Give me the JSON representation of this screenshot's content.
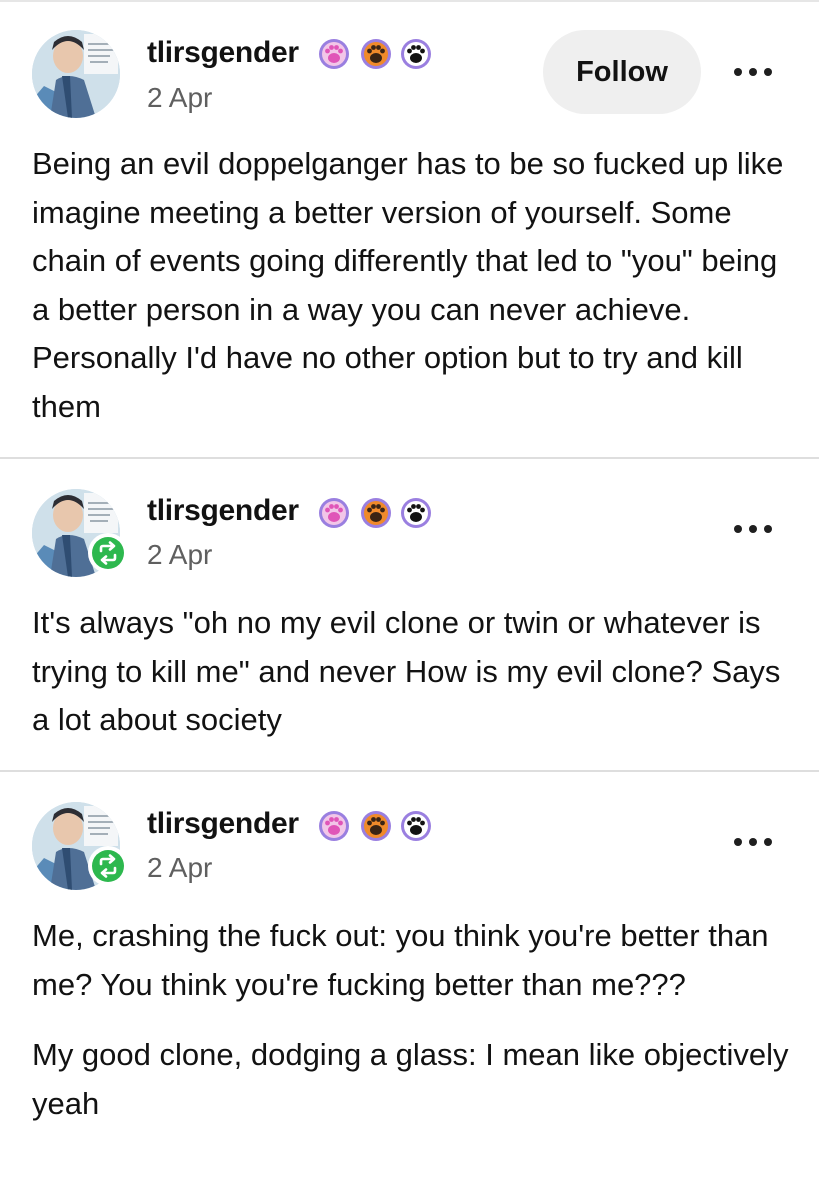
{
  "posts": [
    {
      "username": "tlirsgender",
      "date": "2 Apr",
      "follow_label": "Follow",
      "paragraphs": [
        "Being an evil doppelganger has to be so fucked up like imagine meeting a better version of yourself. Some chain of events going differently that led to \"you\" being a better person in a way you can never achieve. Personally I'd have no other option but to try and kill them"
      ]
    },
    {
      "username": "tlirsgender",
      "date": "2 Apr",
      "reblog_icon": "reblog-icon",
      "paragraphs": [
        "It's always \"oh no my evil clone or twin or whatever is trying to kill me\" and never How is my evil clone? Says a lot about society"
      ]
    },
    {
      "username": "tlirsgender",
      "date": "2 Apr",
      "reblog_icon": "reblog-icon",
      "paragraphs": [
        "Me, crashing the fuck out: you think you're better than me? You think you're fucking better than me???",
        "My good clone, dodging a glass: I mean like objectively yeah"
      ]
    }
  ],
  "badge_icons": [
    "pink-paw-badge-icon",
    "orange-paw-badge-icon",
    "black-paw-badge-icon"
  ],
  "more_icon": "more-options-icon",
  "colors": {
    "reblog_green": "#2db84e",
    "follow_bg": "#efefef",
    "text": "#121212",
    "muted": "#5f5f5f",
    "badge_pink": "#e679cc",
    "badge_orange": "#f08a2a",
    "badge_purple": "#9a7fe0"
  }
}
